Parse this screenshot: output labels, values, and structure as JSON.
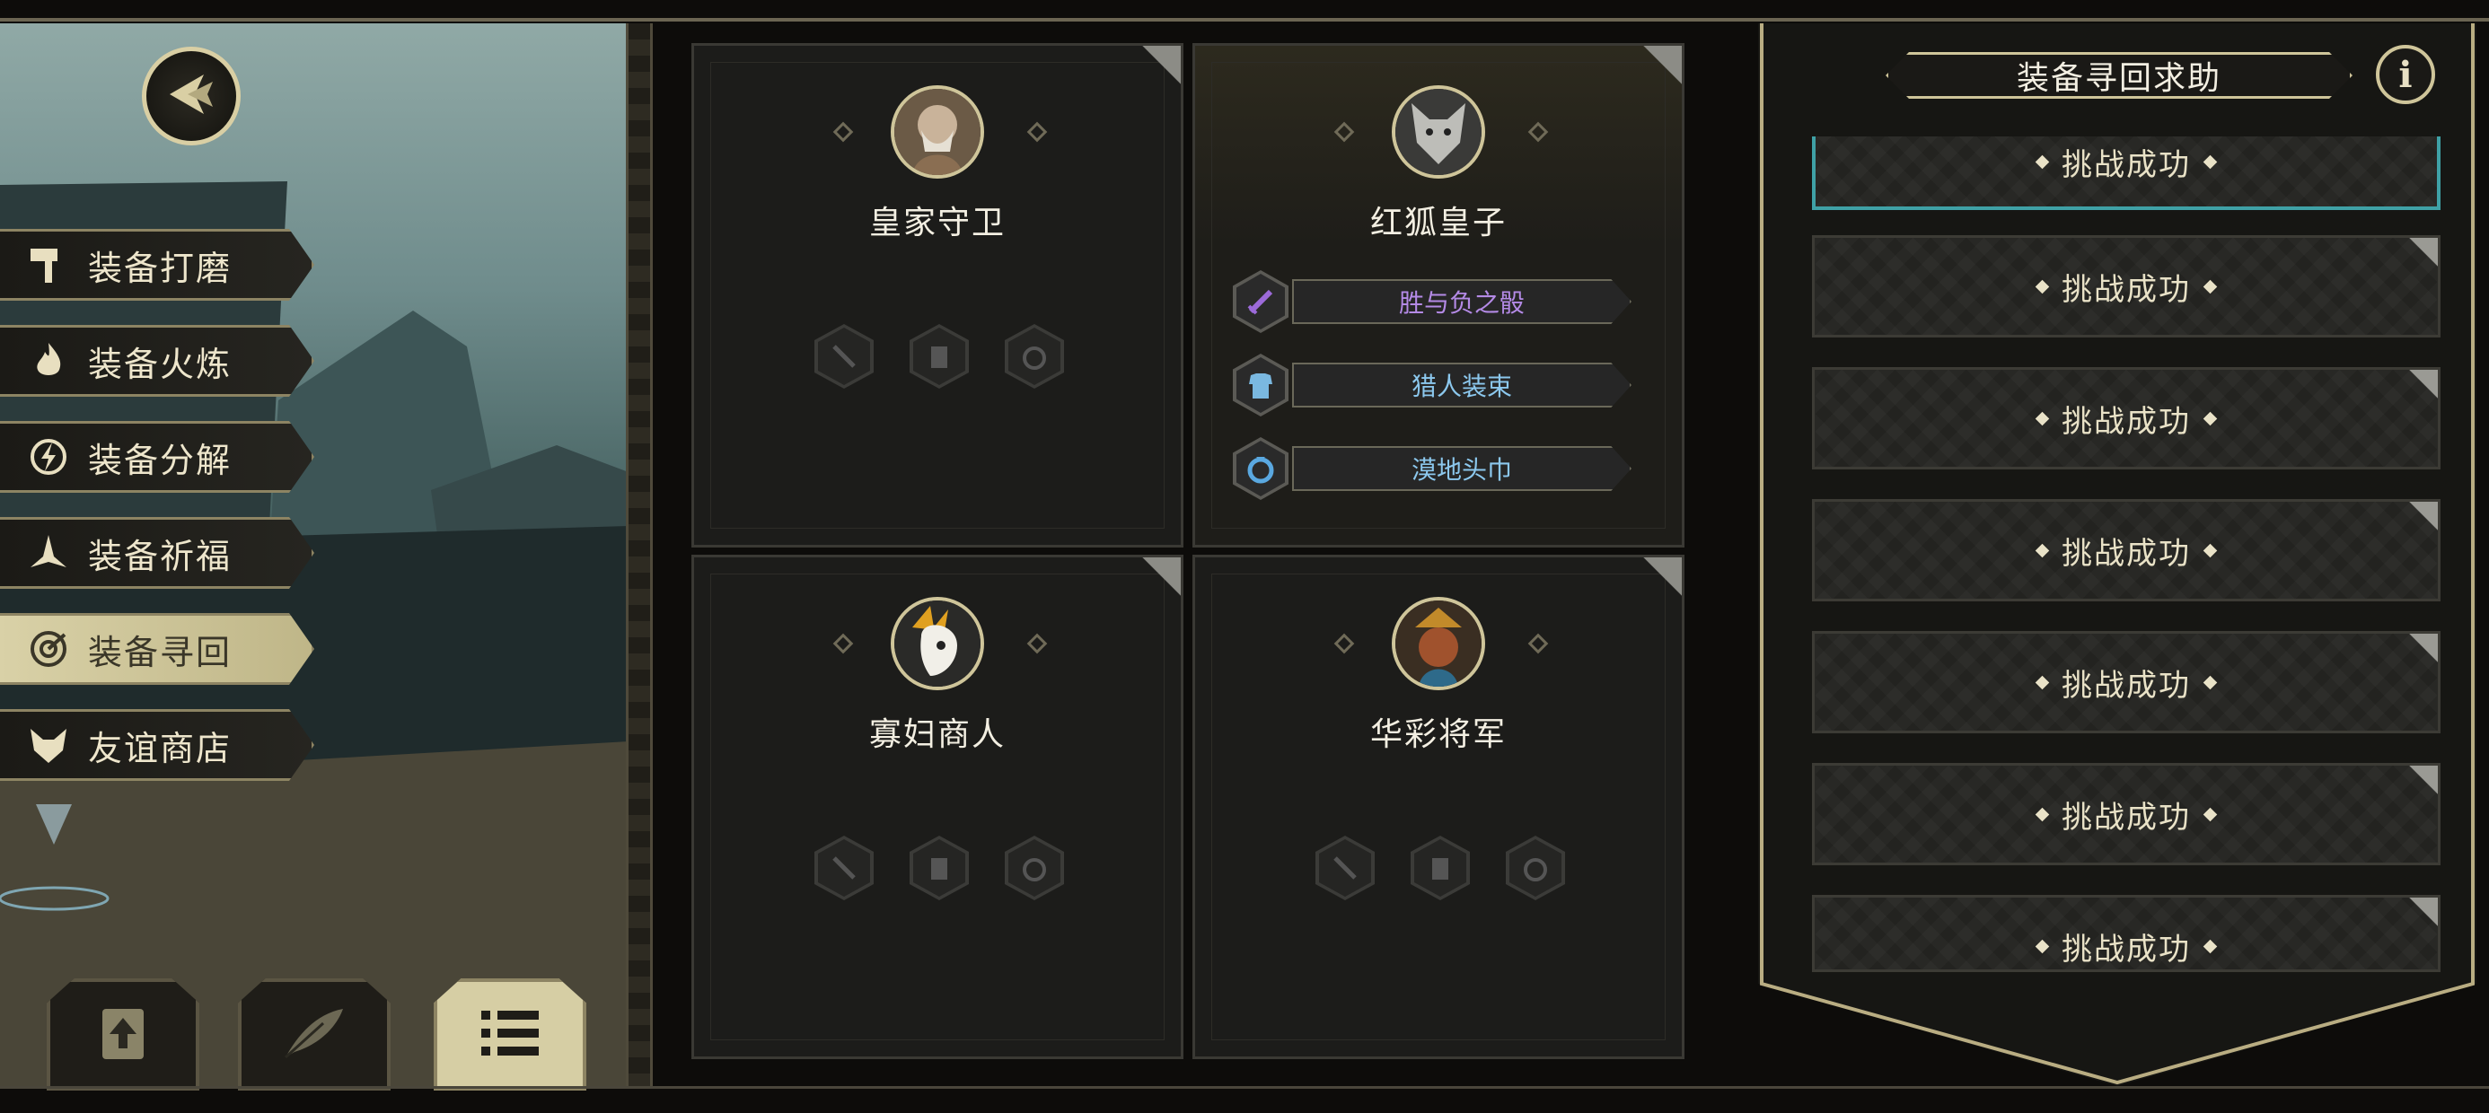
{
  "back_button": {
    "icon": "back-arrow-icon"
  },
  "menu": [
    {
      "label": "装备打磨",
      "icon": "hammer-icon",
      "active": false
    },
    {
      "label": "装备火炼",
      "icon": "flame-icon",
      "active": false
    },
    {
      "label": "装备分解",
      "icon": "disassemble-icon",
      "active": false
    },
    {
      "label": "装备祈福",
      "icon": "pray-icon",
      "active": false
    },
    {
      "label": "装备寻回",
      "icon": "target-icon",
      "active": true
    },
    {
      "label": "友谊商店",
      "icon": "fox-icon",
      "active": false
    }
  ],
  "bottom_buttons": [
    {
      "icon": "upload-icon",
      "active": false
    },
    {
      "icon": "feather-icon",
      "active": false
    },
    {
      "icon": "list-icon",
      "active": true
    }
  ],
  "characters": [
    {
      "name": "皇家守卫",
      "equipment": []
    },
    {
      "name": "红狐皇子",
      "equipment": [
        {
          "name": "胜与负之骰",
          "icon": "sword-icon",
          "color": "#b48ae6"
        },
        {
          "name": "猎人装束",
          "icon": "armor-icon",
          "color": "#8cc8ee"
        },
        {
          "name": "漠地头巾",
          "icon": "ring-icon",
          "color": "#8cc8ee"
        }
      ]
    },
    {
      "name": "寡妇商人",
      "equipment": []
    },
    {
      "name": "华彩将军",
      "equipment": []
    }
  ],
  "panel": {
    "title": "装备寻回求助",
    "info_label": "i",
    "requests": [
      "挑战成功",
      "挑战成功",
      "挑战成功",
      "挑战成功",
      "挑战成功",
      "挑战成功",
      "挑战成功"
    ]
  }
}
